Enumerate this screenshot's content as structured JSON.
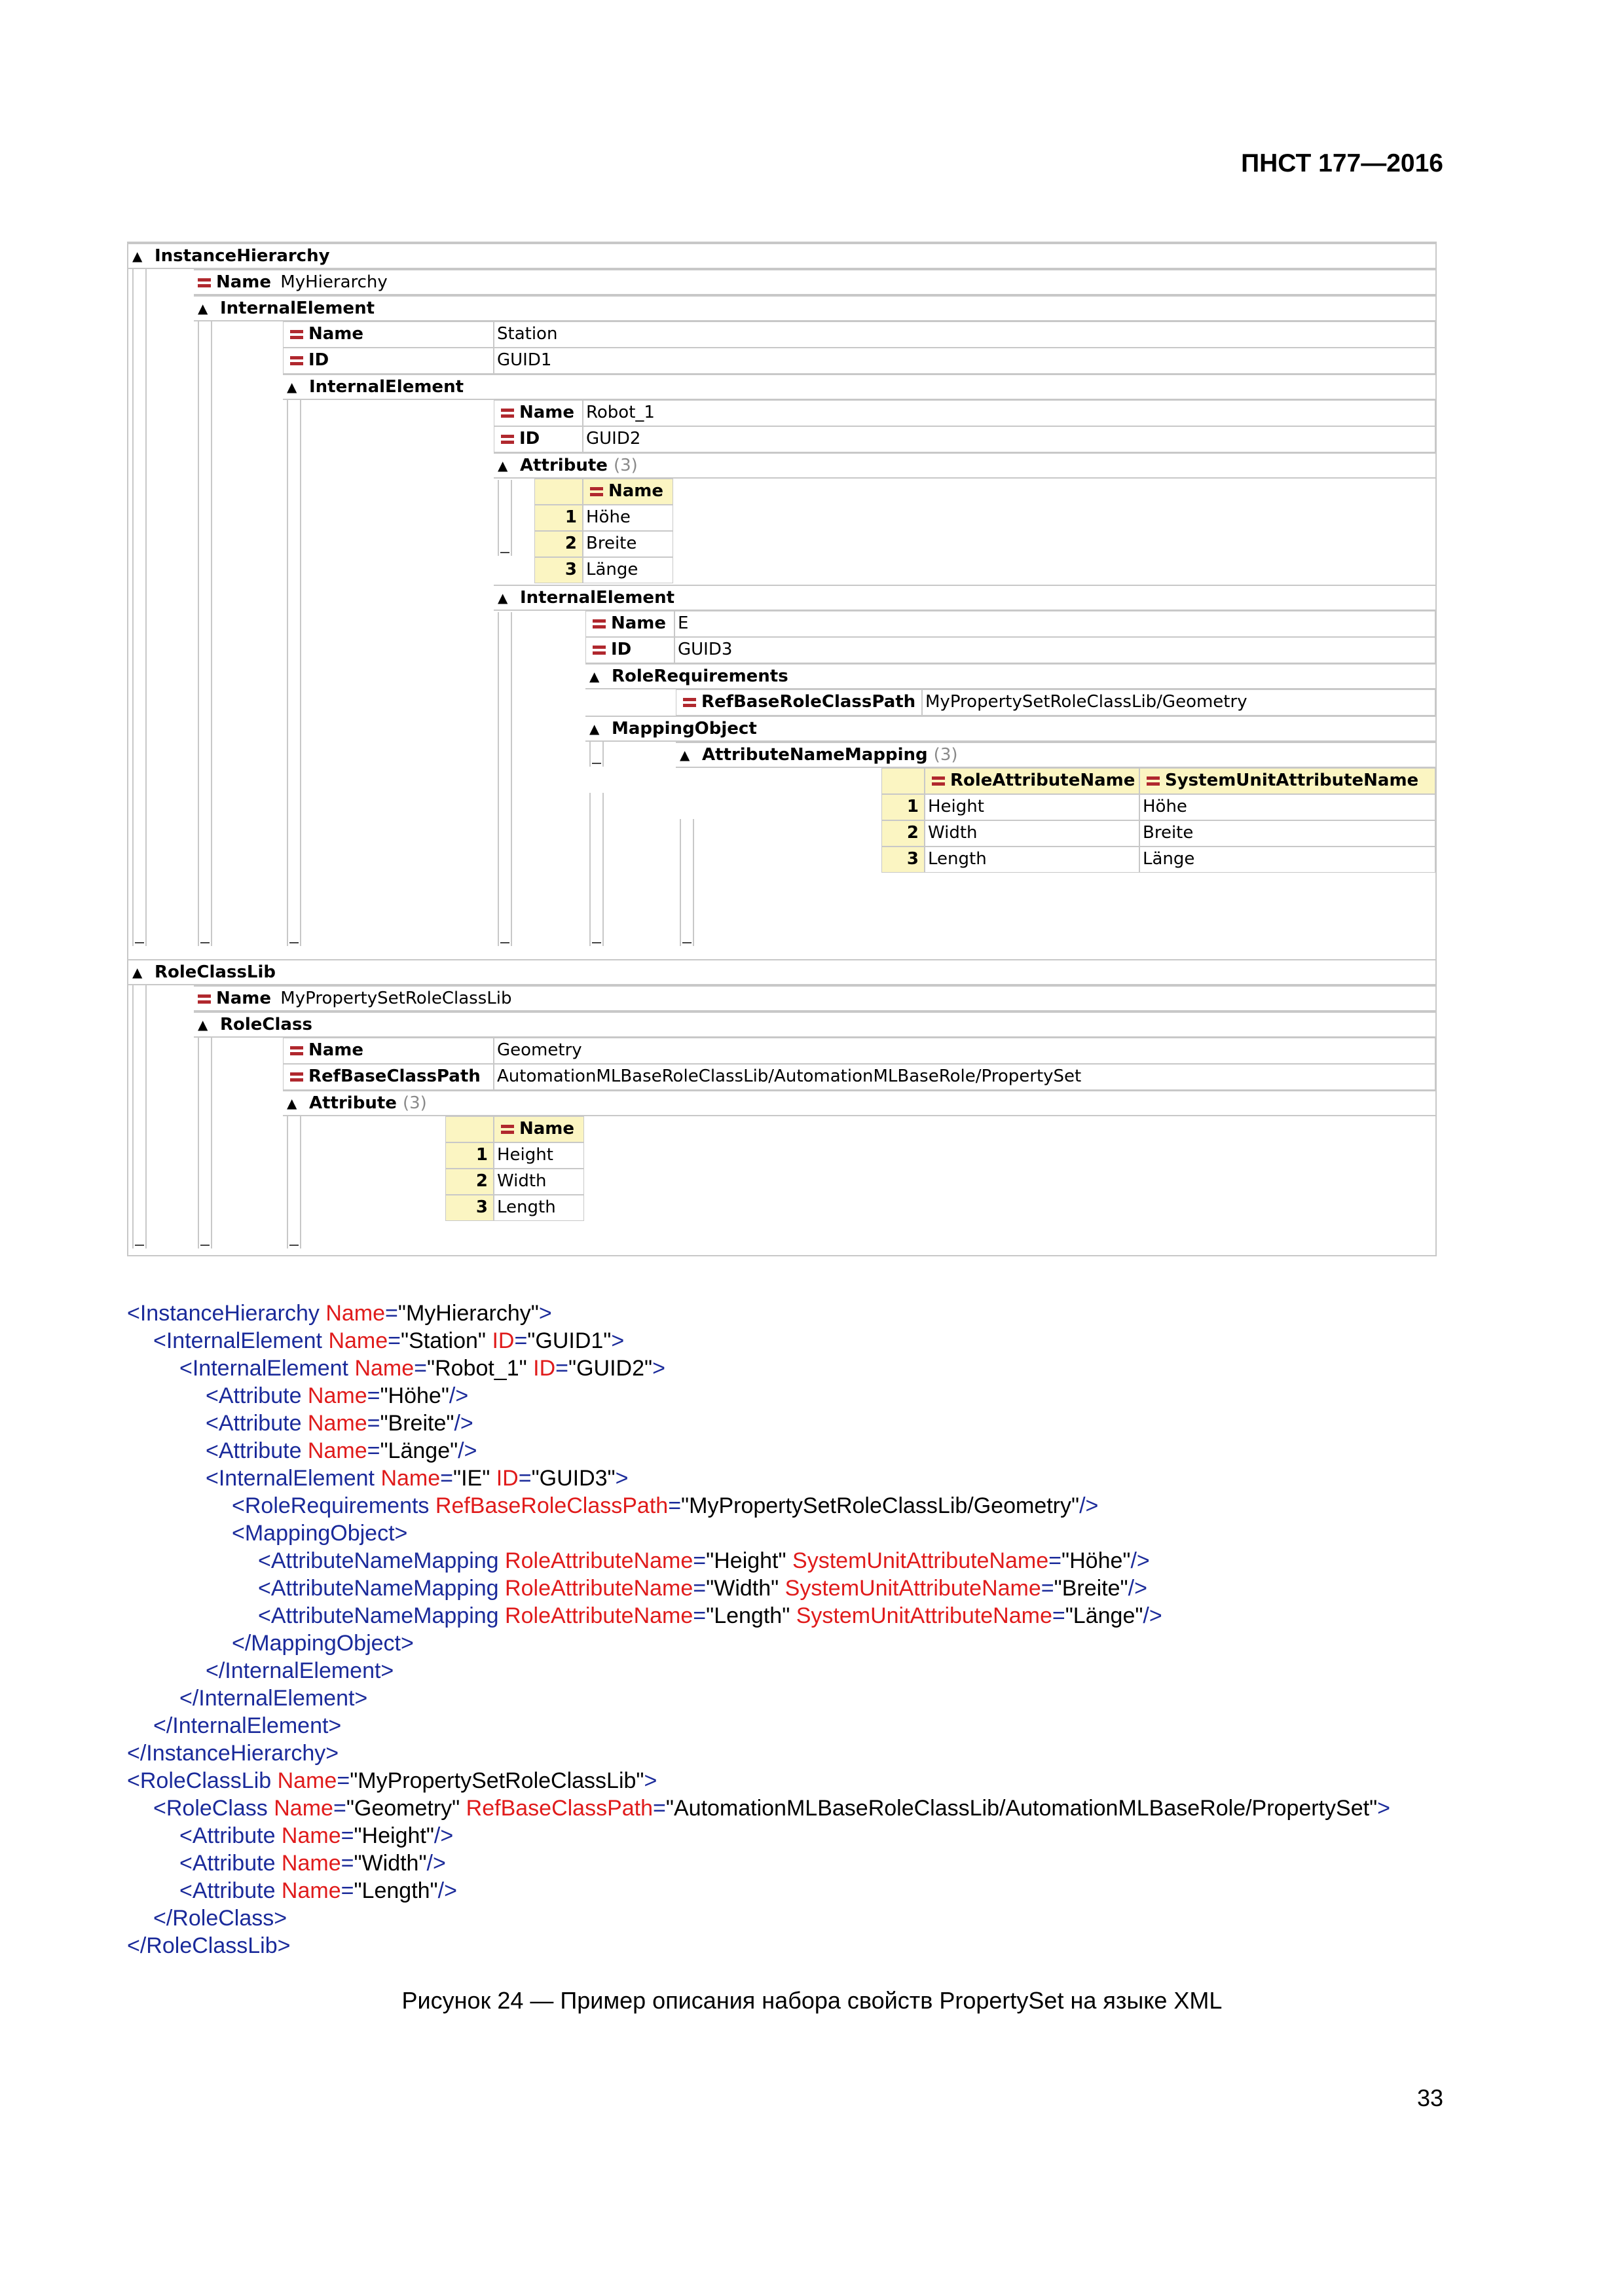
{
  "header": {
    "doc_id": "ПНСТ 177—2016"
  },
  "tree": {
    "instance_hierarchy": "InstanceHierarchy",
    "name_key": "Name",
    "id_key": "ID",
    "hierarchy_name": "MyHierarchy",
    "internal_element": "InternalElement",
    "station_name": "Station",
    "station_id": "GUID1",
    "robot_name": "Robot_1",
    "robot_id": "GUID2",
    "attribute": "Attribute",
    "count3": "(3)",
    "attr_rows": [
      {
        "n": "1",
        "v": "Höhe"
      },
      {
        "n": "2",
        "v": "Breite"
      },
      {
        "n": "3",
        "v": "Länge"
      }
    ],
    "ie_name": "E",
    "ie_id": "GUID3",
    "role_requirements": "RoleRequirements",
    "ref_base_role_class_path": "RefBaseRoleClassPath",
    "ref_base_role_class_value": "MyPropertySetRoleClassLib/Geometry",
    "mapping_object": "MappingObject",
    "attribute_name_mapping": "AttributeNameMapping",
    "role_attribute_name": "RoleAttributeName",
    "system_unit_attribute_name": "SystemUnitAttributeName",
    "mapping_rows": [
      {
        "n": "1",
        "role": "Height",
        "sys": "Höhe"
      },
      {
        "n": "2",
        "role": "Width",
        "sys": "Breite"
      },
      {
        "n": "3",
        "role": "Length",
        "sys": "Länge"
      }
    ],
    "role_class_lib": "RoleClassLib",
    "lib_name": "MyPropertySetRoleClassLib",
    "role_class": "RoleClass",
    "rc_name": "Geometry",
    "ref_base_class_path": "RefBaseClassPath",
    "ref_base_class_value": "AutomationMLBaseRoleClassLib/AutomationMLBaseRole/PropertySet",
    "rc_attr_rows": [
      {
        "n": "1",
        "v": "Height"
      },
      {
        "n": "2",
        "v": "Width"
      },
      {
        "n": "3",
        "v": "Length"
      }
    ]
  },
  "xml_lines": [
    {
      "indent": 0,
      "parts": [
        [
          "t",
          "<InstanceHierarchy "
        ],
        [
          "a",
          "Name"
        ],
        [
          "t",
          "="
        ],
        [
          "v",
          "\"MyHierarchy\""
        ],
        [
          "t",
          ">"
        ]
      ]
    },
    {
      "indent": 1,
      "parts": [
        [
          "t",
          "<InternalElement "
        ],
        [
          "a",
          "Name"
        ],
        [
          "t",
          "="
        ],
        [
          "v",
          "\"Station\" "
        ],
        [
          "a",
          "ID"
        ],
        [
          "t",
          "="
        ],
        [
          "v",
          "\"GUID1\""
        ],
        [
          "t",
          ">"
        ]
      ]
    },
    {
      "indent": 2,
      "parts": [
        [
          "t",
          "<InternalElement "
        ],
        [
          "a",
          "Name"
        ],
        [
          "t",
          "="
        ],
        [
          "v",
          "\"Robot_1\" "
        ],
        [
          "a",
          "ID"
        ],
        [
          "t",
          "="
        ],
        [
          "v",
          "\"GUID2\""
        ],
        [
          "t",
          ">"
        ]
      ]
    },
    {
      "indent": 3,
      "parts": [
        [
          "t",
          "<Attribute "
        ],
        [
          "a",
          "Name"
        ],
        [
          "t",
          "="
        ],
        [
          "v",
          "\"Höhe\""
        ],
        [
          "t",
          "/>"
        ]
      ]
    },
    {
      "indent": 3,
      "parts": [
        [
          "t",
          "<Attribute "
        ],
        [
          "a",
          "Name"
        ],
        [
          "t",
          "="
        ],
        [
          "v",
          "\"Breite\""
        ],
        [
          "t",
          "/>"
        ]
      ]
    },
    {
      "indent": 3,
      "parts": [
        [
          "t",
          "<Attribute "
        ],
        [
          "a",
          "Name"
        ],
        [
          "t",
          "="
        ],
        [
          "v",
          "\"Länge\""
        ],
        [
          "t",
          "/>"
        ]
      ]
    },
    {
      "indent": 3,
      "parts": [
        [
          "t",
          "<InternalElement "
        ],
        [
          "a",
          "Name"
        ],
        [
          "t",
          "="
        ],
        [
          "v",
          "\"IE\" "
        ],
        [
          "a",
          "ID"
        ],
        [
          "t",
          "="
        ],
        [
          "v",
          "\"GUID3\""
        ],
        [
          "t",
          ">"
        ]
      ]
    },
    {
      "indent": 4,
      "parts": [
        [
          "t",
          "<RoleRequirements "
        ],
        [
          "a",
          "RefBaseRoleClassPath"
        ],
        [
          "t",
          "="
        ],
        [
          "v",
          "\"MyPropertySetRoleClassLib/Geometry\""
        ],
        [
          "t",
          "/>"
        ]
      ]
    },
    {
      "indent": 4,
      "parts": [
        [
          "t",
          "<MappingObject>"
        ]
      ]
    },
    {
      "indent": 5,
      "parts": [
        [
          "t",
          "<AttributeNameMapping "
        ],
        [
          "a",
          "RoleAttributeName"
        ],
        [
          "t",
          "="
        ],
        [
          "v",
          "\"Height\" "
        ],
        [
          "a",
          "SystemUnitAttributeName"
        ],
        [
          "t",
          "="
        ],
        [
          "v",
          "\"Höhe\""
        ],
        [
          "t",
          "/>"
        ]
      ]
    },
    {
      "indent": 5,
      "parts": [
        [
          "t",
          "<AttributeNameMapping "
        ],
        [
          "a",
          "RoleAttributeName"
        ],
        [
          "t",
          "="
        ],
        [
          "v",
          "\"Width\" "
        ],
        [
          "a",
          "SystemUnitAttributeName"
        ],
        [
          "t",
          "="
        ],
        [
          "v",
          "\"Breite\""
        ],
        [
          "t",
          "/>"
        ]
      ]
    },
    {
      "indent": 5,
      "parts": [
        [
          "t",
          "<AttributeNameMapping "
        ],
        [
          "a",
          "RoleAttributeName"
        ],
        [
          "t",
          "="
        ],
        [
          "v",
          "\"Length\" "
        ],
        [
          "a",
          "SystemUnitAttributeName"
        ],
        [
          "t",
          "="
        ],
        [
          "v",
          "\"Länge\""
        ],
        [
          "t",
          "/>"
        ]
      ]
    },
    {
      "indent": 4,
      "parts": [
        [
          "t",
          "</MappingObject>"
        ]
      ]
    },
    {
      "indent": 3,
      "parts": [
        [
          "t",
          "</InternalElement>"
        ]
      ]
    },
    {
      "indent": 2,
      "parts": [
        [
          "t",
          "</InternalElement>"
        ]
      ]
    },
    {
      "indent": 1,
      "parts": [
        [
          "t",
          "</InternalElement>"
        ]
      ]
    },
    {
      "indent": 0,
      "parts": [
        [
          "t",
          "</InstanceHierarchy>"
        ]
      ]
    },
    {
      "indent": 0,
      "parts": [
        [
          "t",
          "<RoleClassLib "
        ],
        [
          "a",
          "Name"
        ],
        [
          "t",
          "="
        ],
        [
          "v",
          "\"MyPropertySetRoleClassLib\""
        ],
        [
          "t",
          ">"
        ]
      ]
    },
    {
      "indent": 1,
      "parts": [
        [
          "t",
          "<RoleClass "
        ],
        [
          "a",
          "Name"
        ],
        [
          "t",
          "="
        ],
        [
          "v",
          "\"Geometry\" "
        ],
        [
          "a",
          "RefBaseClassPath"
        ],
        [
          "t",
          "="
        ],
        [
          "v",
          "\"AutomationMLBaseRoleClassLib/AutomationMLBaseRole/PropertySet\""
        ],
        [
          "t",
          ">"
        ]
      ]
    },
    {
      "indent": 2,
      "parts": [
        [
          "t",
          "<Attribute "
        ],
        [
          "a",
          "Name"
        ],
        [
          "t",
          "="
        ],
        [
          "v",
          "\"Height\""
        ],
        [
          "t",
          "/>"
        ]
      ]
    },
    {
      "indent": 2,
      "parts": [
        [
          "t",
          "<Attribute "
        ],
        [
          "a",
          "Name"
        ],
        [
          "t",
          "="
        ],
        [
          "v",
          "\"Width\""
        ],
        [
          "t",
          "/>"
        ]
      ]
    },
    {
      "indent": 2,
      "parts": [
        [
          "t",
          "<Attribute "
        ],
        [
          "a",
          "Name"
        ],
        [
          "t",
          "="
        ],
        [
          "v",
          "\"Length\""
        ],
        [
          "t",
          "/>"
        ]
      ]
    },
    {
      "indent": 1,
      "parts": [
        [
          "t",
          "</RoleClass>"
        ]
      ]
    },
    {
      "indent": 0,
      "parts": [
        [
          "t",
          "</RoleClassLib>"
        ]
      ]
    }
  ],
  "caption": "Рисунок 24 — Пример описания набора свойств PropertySet на языке XML",
  "page_number": "33"
}
